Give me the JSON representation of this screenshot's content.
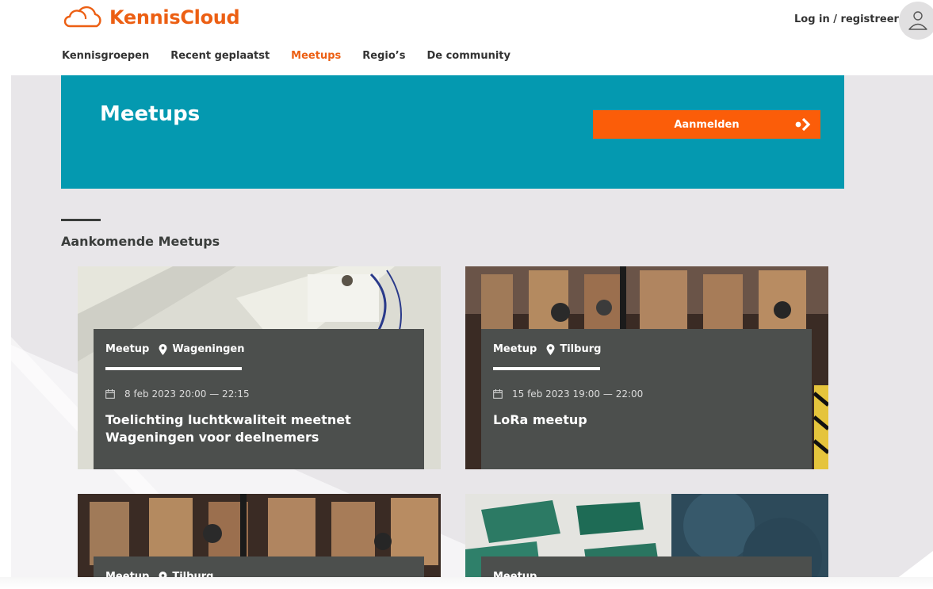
{
  "header": {
    "logo_text": "KennisCloud",
    "login_label": "Log in / registreer"
  },
  "nav": {
    "items": [
      {
        "label": "Kennisgroepen"
      },
      {
        "label": "Recent geplaatst"
      },
      {
        "label": "Meetups"
      },
      {
        "label": "Regio’s"
      },
      {
        "label": "De community"
      }
    ],
    "active": "Meetups"
  },
  "hero": {
    "title": "Meetups",
    "button_label": "Aanmelden"
  },
  "section": {
    "title": "Aankomende Meetups"
  },
  "cards": [
    {
      "type": "Meetup",
      "location": "Wageningen",
      "date": "8 feb 2023 20:00 — 22:15",
      "title": "Toelichting luchtkwaliteit meetnet Wageningen voor deelnemers"
    },
    {
      "type": "Meetup",
      "location": "Tilburg",
      "date": "15 feb 2023 19:00 — 22:00",
      "title": "LoRa meetup"
    },
    {
      "type": "Meetup",
      "location": "Tilburg"
    },
    {
      "type": "Meetup"
    }
  ],
  "colors": {
    "brand_orange": "#ec5f13",
    "button_orange": "#fb5d09",
    "hero_teal": "#0499b0",
    "card_panel": "#4c4f4d",
    "page_grey": "#e8e6e9"
  },
  "icons": [
    "cloud-logo-icon",
    "user-icon",
    "arrow-right-icon",
    "location-pin-icon",
    "calendar-icon"
  ]
}
